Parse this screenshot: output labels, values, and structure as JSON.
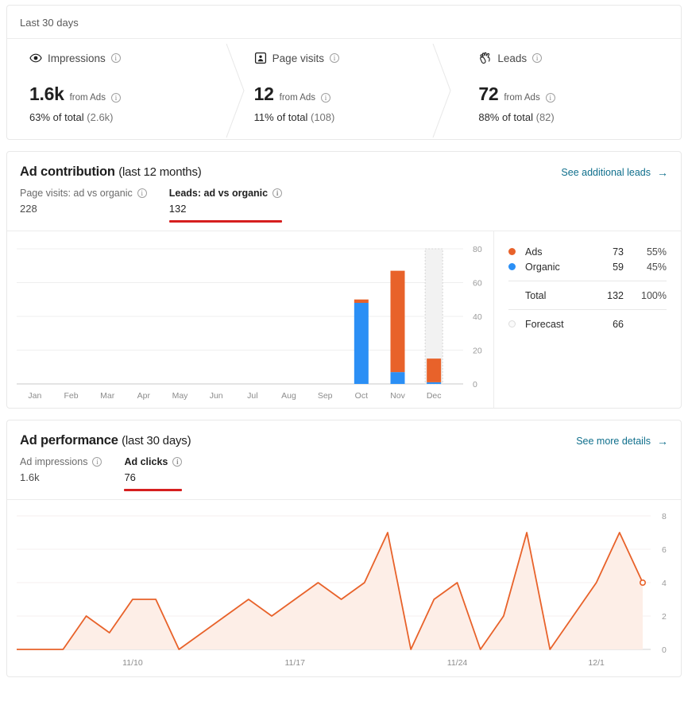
{
  "kpi": {
    "range_label": "Last 30 days",
    "metrics": [
      {
        "icon": "eye-icon",
        "title": "Impressions",
        "value": "1.6k",
        "from_label": "from Ads",
        "share_pct": "63% of total ",
        "share_total": "(2.6k)"
      },
      {
        "icon": "page-visits-icon",
        "title": "Page visits",
        "value": "12",
        "from_label": "from Ads",
        "share_pct": "11% of total ",
        "share_total": "(108)"
      },
      {
        "icon": "clap-hand-icon",
        "title": "Leads",
        "value": "72",
        "from_label": "from Ads",
        "share_pct": "88% of total ",
        "share_total": "(82)"
      }
    ]
  },
  "contribution": {
    "title": "Ad contribution",
    "subtitle": "(last 12 months)",
    "link_label": "See additional leads",
    "link_arrow": "→",
    "tabs": [
      {
        "label": "Page visits: ad vs organic",
        "value": "228",
        "active": false
      },
      {
        "label": "Leads: ad vs organic",
        "value": "132",
        "active": true
      }
    ],
    "legend": {
      "rows": [
        {
          "name": "Ads",
          "value": "73",
          "pct": "55%",
          "color": "#e8622a",
          "style": "solid"
        },
        {
          "name": "Organic",
          "value": "59",
          "pct": "45%",
          "color": "#2b8ff5",
          "style": "solid"
        }
      ],
      "total": {
        "name": "Total",
        "value": "132",
        "pct": "100%"
      },
      "forecast": {
        "name": "Forecast",
        "value": "66",
        "pct": "",
        "style": "hollow"
      }
    },
    "accent_red": "#d61f1f",
    "chart_data": {
      "type": "bar",
      "stacked": true,
      "title": "Leads: ad vs organic (last 12 months)",
      "xlabel": "",
      "ylabel": "",
      "ylim": [
        0,
        80
      ],
      "yticks": [
        0,
        20,
        40,
        60,
        80
      ],
      "grid": true,
      "legend_position": "right",
      "categories": [
        "Jan",
        "Feb",
        "Mar",
        "Apr",
        "May",
        "Jun",
        "Jul",
        "Aug",
        "Sep",
        "Oct",
        "Nov",
        "Dec"
      ],
      "series": [
        {
          "name": "Organic",
          "color": "#2b8ff5",
          "values": [
            0,
            0,
            0,
            0,
            0,
            0,
            0,
            0,
            0,
            48,
            7,
            1
          ]
        },
        {
          "name": "Ads",
          "color": "#e8622a",
          "values": [
            0,
            0,
            0,
            0,
            0,
            0,
            0,
            0,
            0,
            2,
            60,
            14
          ]
        }
      ],
      "forecast": {
        "name": "Forecast",
        "category": "Dec",
        "value": 80,
        "color": "#f0f0f0"
      },
      "annotations": []
    }
  },
  "performance": {
    "title": "Ad performance",
    "subtitle": "(last 30 days)",
    "link_label": "See more details",
    "link_arrow": "→",
    "tabs": [
      {
        "label": "Ad impressions",
        "value": "1.6k",
        "active": false
      },
      {
        "label": "Ad clicks",
        "value": "76",
        "active": true
      }
    ],
    "accent_red": "#d61f1f",
    "chart_data": {
      "type": "area",
      "title": "Ad clicks (last 30 days)",
      "xlabel": "",
      "ylabel": "",
      "ylim": [
        0,
        8
      ],
      "yticks": [
        0,
        2,
        4,
        6,
        8
      ],
      "grid": true,
      "line_color": "#e8622a",
      "fill_color": "#fdeee7",
      "xticks": [
        "11/10",
        "11/17",
        "11/24",
        "12/1"
      ],
      "xtick_indices": [
        5,
        12,
        19,
        25
      ],
      "x": [
        0,
        1,
        2,
        3,
        4,
        5,
        6,
        7,
        8,
        9,
        10,
        11,
        12,
        13,
        14,
        15,
        16,
        17,
        18,
        19,
        20,
        21,
        22,
        23,
        24,
        25,
        26,
        27,
        28,
        29
      ],
      "values": [
        0,
        0,
        0,
        2,
        1,
        3,
        3,
        0,
        1,
        2,
        3,
        2,
        3,
        4,
        3,
        4,
        7,
        0,
        3,
        4,
        0,
        2,
        7,
        0,
        2,
        4,
        7,
        4
      ],
      "last_point_marker": {
        "value": 4,
        "style": "open-circle"
      }
    }
  }
}
